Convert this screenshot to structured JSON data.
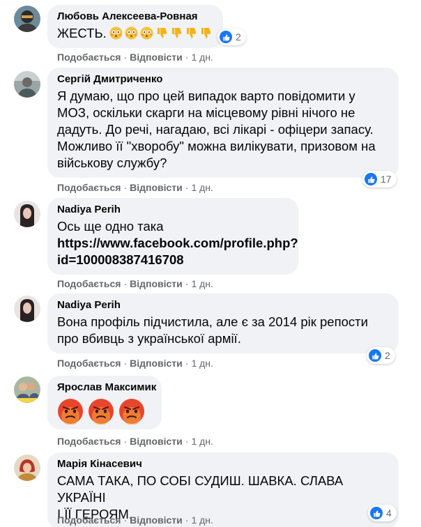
{
  "comments": [
    {
      "author": "Любовь Алексеева-Ровная",
      "text": "ЖЕСТЬ.",
      "emojis": [
        "flushed-face",
        "flushed-face",
        "flushed-face",
        "thumbs-down",
        "thumbs-down",
        "thumbs-down",
        "thumbs-down"
      ],
      "reaction_count": "2",
      "like_label": "Подобається",
      "reply_label": "Відповісти",
      "time": "1 дн."
    },
    {
      "author": "Сергій Дмитриченко",
      "lines": [
        "Я думаю, що про цей випадок варто повідомити у",
        "МОЗ, оскільки скарги на місцевому рівні нічого не",
        "дадуть. До речі, нагадаю, всі лікарі - офіцери запасу.",
        "Можливо її \"хворобу\" можна вилікувати, призовом на",
        "військову службу?"
      ],
      "reaction_count": "17",
      "like_label": "Подобається",
      "reply_label": "Відповісти",
      "time": "1 дн."
    },
    {
      "author": "Nadiya Perih",
      "text": "Ось ще одно така",
      "link_lines": [
        "https://www.facebook.com/profile.php?",
        "id=100008387416708"
      ],
      "like_label": "Подобається",
      "reply_label": "Відповісти",
      "time": "1 дн."
    },
    {
      "author": "Nadiya Perih",
      "lines": [
        "Вона профіль підчистила, але є за 2014 рік репости",
        "про вбивць з української армії."
      ],
      "reaction_count": "2",
      "like_label": "Подобається",
      "reply_label": "Відповісти",
      "time": "1 дн."
    },
    {
      "author": "Ярослав Максимик",
      "emojis": [
        "angry-face",
        "angry-face",
        "angry-face"
      ],
      "like_label": "Подобається",
      "reply_label": "Відповісти",
      "time": "1 дн."
    },
    {
      "author": "Марія Кінасевич",
      "lines": [
        "САМА ТАКА, ПО СОБІ СУДИШ. ШАВКА. СЛАВА УКРАЇНІ",
        "І ЇЇ ГЕРОЯМ."
      ],
      "reaction_count": "4",
      "like_label": "Подобається",
      "reply_label": "Відповісти",
      "time": "1 дн."
    }
  ],
  "separator": "·",
  "colors": {
    "bubble": "#f0f2f5",
    "like_blue": "#1877f2",
    "meta_gray": "#65676b",
    "emoji_angry": "#e8452c",
    "emoji_yellow": "#f7c23b"
  }
}
